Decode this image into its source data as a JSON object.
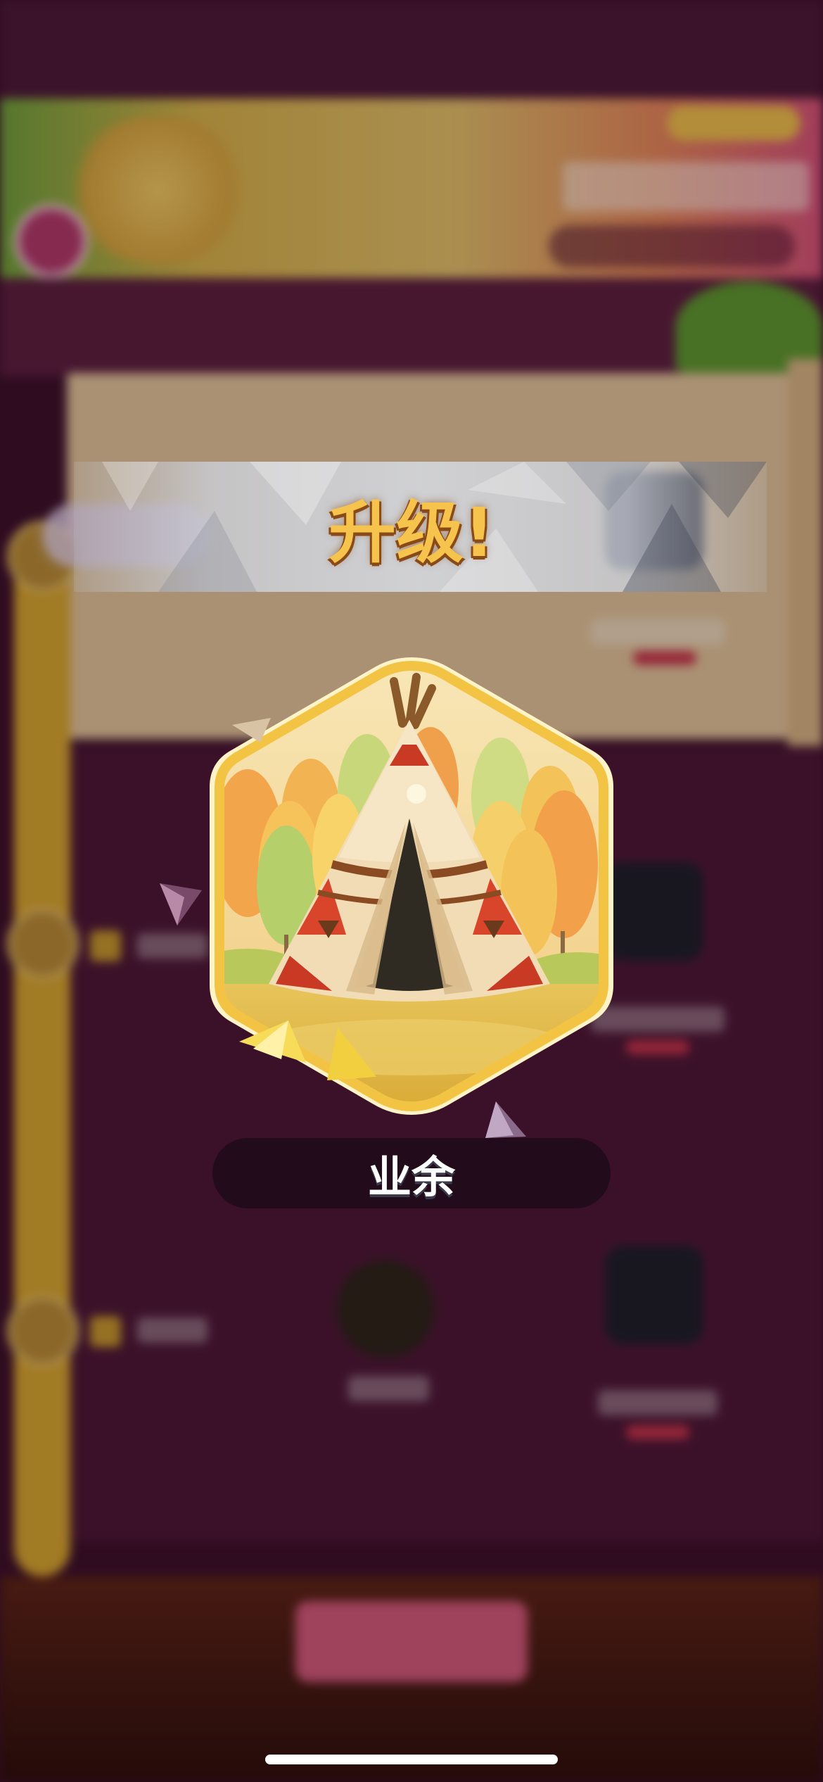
{
  "popup": {
    "title": "升级!",
    "rank_name": "业余",
    "badge_icon": "teepee-tent-icon"
  },
  "colors": {
    "title_gold": "#f6c44d",
    "title_outline": "#8a4a18",
    "background_purple": "#4a1734",
    "pill_dark": "#1e0a19"
  }
}
